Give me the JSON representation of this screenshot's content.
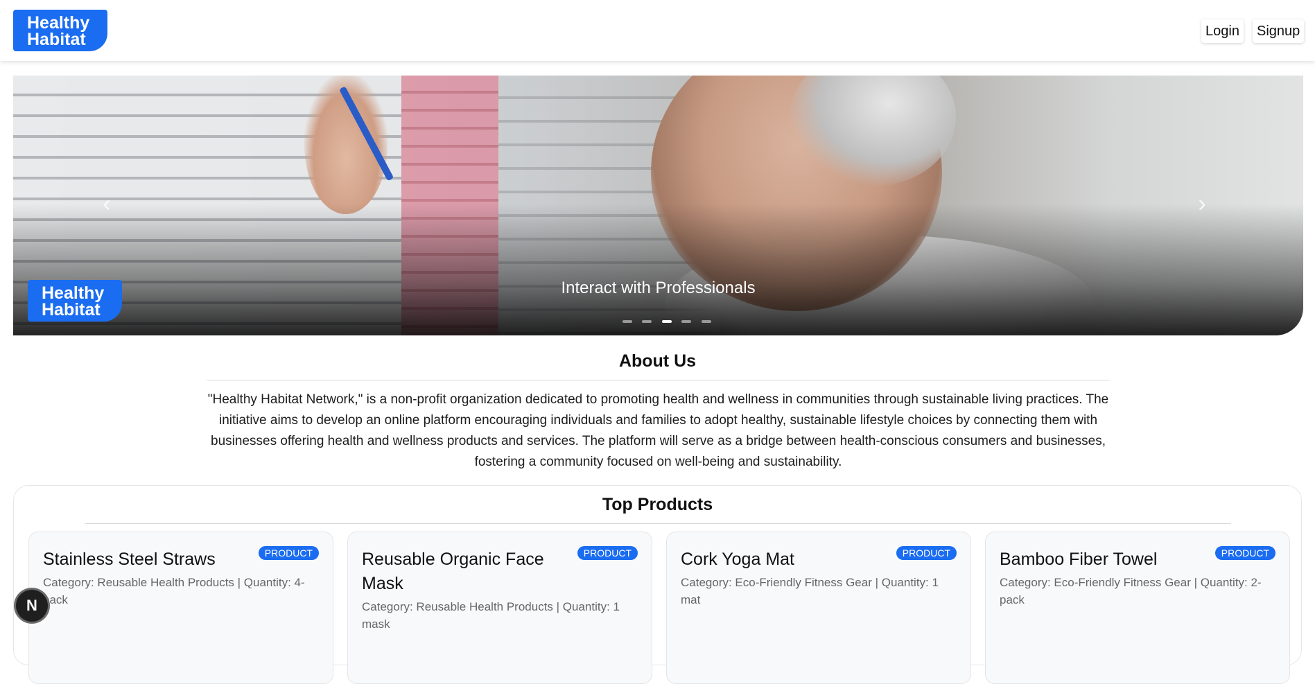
{
  "header": {
    "logo_line1": "Healthy",
    "logo_line2": "Habitat",
    "login_label": "Login",
    "signup_label": "Signup"
  },
  "hero": {
    "prev_icon": "‹",
    "next_icon": "›",
    "logo_line1": "Healthy",
    "logo_line2": "Habitat",
    "caption": "Interact with Professionals",
    "slide_count": 5,
    "active_slide": 3
  },
  "about": {
    "title": "About Us",
    "text": "\"Healthy Habitat Network,\" is a non-profit organization dedicated to promoting health and wellness in communities through sustainable living practices. The initiative aims to develop an online platform encouraging individuals and families to adopt healthy, sustainable lifestyle choices by connecting them with businesses offering health and wellness products and services. The platform will serve as a bridge between health-conscious consumers and businesses, fostering a community focused on well-being and sustainability."
  },
  "products": {
    "title": "Top Products",
    "items": [
      {
        "name": "Stainless Steel Straws",
        "badge": "PRODUCT",
        "meta": "Category: Reusable Health Products | Quantity: 4-pack"
      },
      {
        "name": "Reusable Organic Face Mask",
        "badge": "PRODUCT",
        "meta": "Category: Reusable Health Products | Quantity: 1 mask"
      },
      {
        "name": "Cork Yoga Mat",
        "badge": "PRODUCT",
        "meta": "Category: Eco-Friendly Fitness Gear | Quantity: 1 mat"
      },
      {
        "name": "Bamboo Fiber Towel",
        "badge": "PRODUCT",
        "meta": "Category: Eco-Friendly Fitness Gear | Quantity: 2-pack"
      }
    ]
  },
  "fab": {
    "label": "N"
  },
  "colors": {
    "brand": "#1a6cf0"
  }
}
